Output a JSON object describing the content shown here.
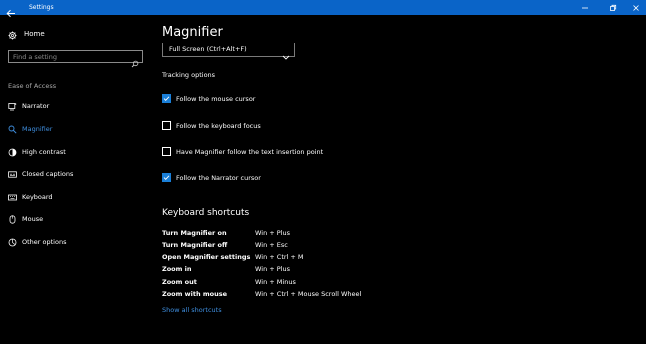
{
  "window": {
    "title": "Settings",
    "titlebar_color": "#0a64c8"
  },
  "sidebar": {
    "home_label": "Home",
    "search_placeholder": "Find a setting",
    "section_label": "Ease of Access",
    "items": [
      {
        "label": "Narrator",
        "icon": "narrator-icon",
        "active": false
      },
      {
        "label": "Magnifier",
        "icon": "magnifier-icon",
        "active": true
      },
      {
        "label": "High contrast",
        "icon": "contrast-icon",
        "active": false
      },
      {
        "label": "Closed captions",
        "icon": "captions-icon",
        "active": false
      },
      {
        "label": "Keyboard",
        "icon": "keyboard-icon",
        "active": false
      },
      {
        "label": "Mouse",
        "icon": "mouse-icon",
        "active": false
      },
      {
        "label": "Other options",
        "icon": "other-options-icon",
        "active": false
      }
    ],
    "accent_color": "#3f8fe0"
  },
  "main": {
    "title": "Magnifier",
    "view_dropdown_value": "Full Screen (Ctrl+Alt+F)",
    "tracking_label": "Tracking options",
    "checkboxes": [
      {
        "label": "Follow the mouse cursor",
        "checked": true
      },
      {
        "label": "Follow the keyboard focus",
        "checked": false
      },
      {
        "label": "Have Magnifier follow the text insertion point",
        "checked": false
      },
      {
        "label": "Follow the Narrator cursor",
        "checked": true
      }
    ],
    "shortcuts_title": "Keyboard shortcuts",
    "shortcuts": [
      {
        "action": "Turn Magnifier on",
        "keys": "Win + Plus"
      },
      {
        "action": "Turn Magnifier off",
        "keys": "Win + Esc"
      },
      {
        "action": "Open Magnifier settings",
        "keys": "Win + Ctrl + M"
      },
      {
        "action": "Zoom in",
        "keys": "Win + Plus"
      },
      {
        "action": "Zoom out",
        "keys": "Win + Minus"
      },
      {
        "action": "Zoom with mouse",
        "keys": "Win + Ctrl + Mouse Scroll Wheel"
      }
    ],
    "show_all_link": "Show all shortcuts"
  }
}
